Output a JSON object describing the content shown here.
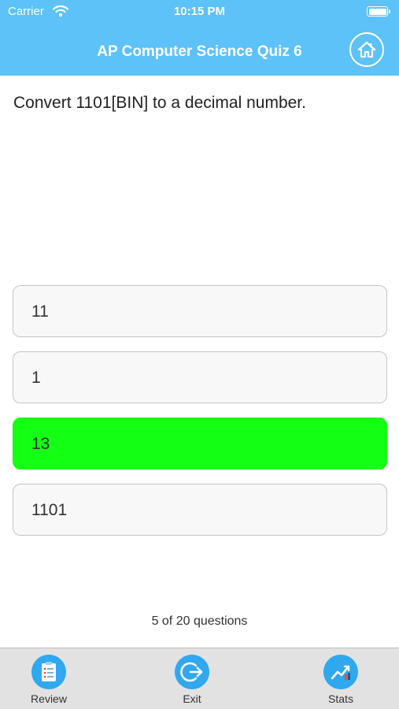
{
  "status_bar": {
    "carrier": "Carrier",
    "time": "10:15 PM"
  },
  "header": {
    "title": "AP Computer Science Quiz 6",
    "home_icon": "home-icon"
  },
  "question": {
    "text": "Convert 1101[BIN] to a decimal number."
  },
  "answers": [
    {
      "label": "11",
      "state": "default"
    },
    {
      "label": "1",
      "state": "default"
    },
    {
      "label": "13",
      "state": "correct"
    },
    {
      "label": "1101",
      "state": "default"
    }
  ],
  "progress": {
    "text": "5 of 20 questions"
  },
  "tabs": [
    {
      "label": "Review",
      "icon": "review-clipboard-icon"
    },
    {
      "label": "Exit",
      "icon": "exit-icon"
    },
    {
      "label": "Stats",
      "icon": "stats-chart-icon"
    }
  ],
  "colors": {
    "header": "#5cc2f8",
    "correct": "#13ff13",
    "tab_icon": "#2fa8ef"
  }
}
